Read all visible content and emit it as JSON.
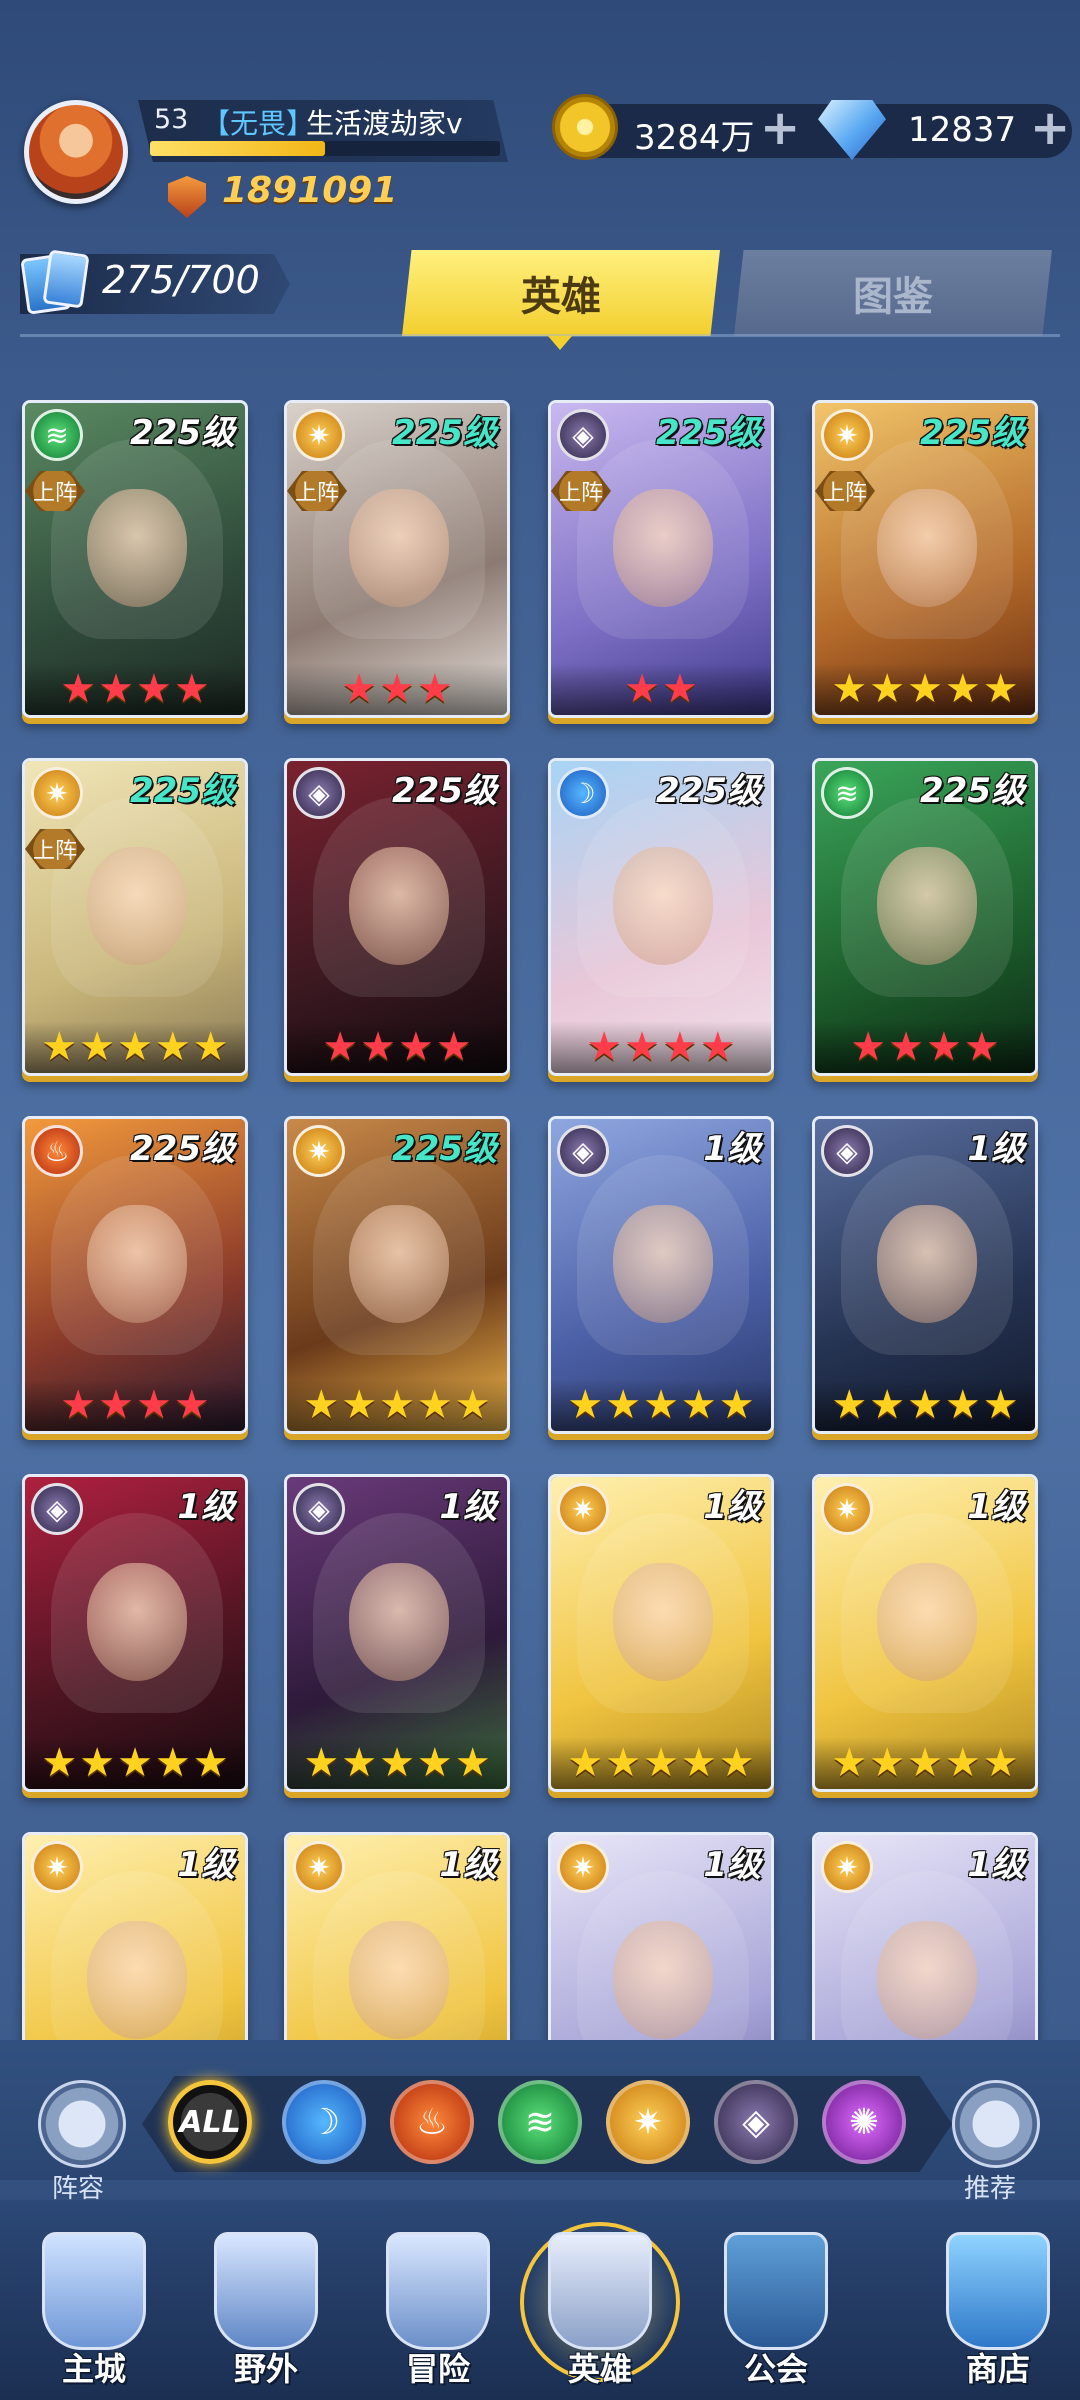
{
  "header": {
    "player_level": "53",
    "title_tag": "【无畏】",
    "player_name": "生活渡劫家v",
    "exp_progress": 0.5,
    "power": "1891091",
    "gold": "3284万",
    "diamonds": "12837",
    "plus": "+"
  },
  "hero_count": "275/700",
  "tabs": {
    "heroes": "英雄",
    "codex": "图鉴"
  },
  "deploy_label": "上阵",
  "heroes": [
    {
      "level": "225级",
      "level_color": "white",
      "faction": "wind",
      "deployed": true,
      "stars": 4,
      "star_color": "red"
    },
    {
      "level": "225级",
      "level_color": "teal",
      "faction": "light",
      "deployed": true,
      "stars": 3,
      "star_color": "red"
    },
    {
      "level": "225级",
      "level_color": "teal",
      "faction": "dark",
      "deployed": true,
      "stars": 2,
      "star_color": "red"
    },
    {
      "level": "225级",
      "level_color": "teal",
      "faction": "light",
      "deployed": true,
      "stars": 5,
      "star_color": "gold"
    },
    {
      "level": "225级",
      "level_color": "teal",
      "faction": "light",
      "deployed": true,
      "stars": 5,
      "star_color": "gold"
    },
    {
      "level": "225级",
      "level_color": "white",
      "faction": "dark",
      "deployed": false,
      "stars": 4,
      "star_color": "red"
    },
    {
      "level": "225级",
      "level_color": "white",
      "faction": "water",
      "deployed": false,
      "stars": 4,
      "star_color": "red"
    },
    {
      "level": "225级",
      "level_color": "white",
      "faction": "wind",
      "deployed": false,
      "stars": 4,
      "star_color": "red"
    },
    {
      "level": "225级",
      "level_color": "white",
      "faction": "fire",
      "deployed": false,
      "stars": 4,
      "star_color": "red"
    },
    {
      "level": "225级",
      "level_color": "teal",
      "faction": "light",
      "deployed": false,
      "stars": 5,
      "star_color": "gold"
    },
    {
      "level": "1级",
      "level_color": "white",
      "faction": "dark",
      "deployed": false,
      "stars": 5,
      "star_color": "gold"
    },
    {
      "level": "1级",
      "level_color": "white",
      "faction": "dark",
      "deployed": false,
      "stars": 5,
      "star_color": "gold"
    },
    {
      "level": "1级",
      "level_color": "white",
      "faction": "dark",
      "deployed": false,
      "stars": 5,
      "star_color": "gold"
    },
    {
      "level": "1级",
      "level_color": "white",
      "faction": "dark",
      "deployed": false,
      "stars": 5,
      "star_color": "gold"
    },
    {
      "level": "1级",
      "level_color": "white",
      "faction": "light",
      "deployed": false,
      "stars": 5,
      "star_color": "gold"
    },
    {
      "level": "1级",
      "level_color": "white",
      "faction": "light",
      "deployed": false,
      "stars": 5,
      "star_color": "gold"
    },
    {
      "level": "1级",
      "level_color": "white",
      "faction": "light",
      "deployed": false,
      "stars": 0,
      "star_color": "gold"
    },
    {
      "level": "1级",
      "level_color": "white",
      "faction": "light",
      "deployed": false,
      "stars": 0,
      "star_color": "gold"
    },
    {
      "level": "1级",
      "level_color": "white",
      "faction": "light",
      "deployed": false,
      "stars": 0,
      "star_color": "gold"
    },
    {
      "level": "1级",
      "level_color": "white",
      "faction": "light",
      "deployed": false,
      "stars": 0,
      "star_color": "gold"
    }
  ],
  "filter": {
    "lineup_label": "阵容",
    "recommend_label": "推荐",
    "all_label": "ALL",
    "factions": [
      "water",
      "fire",
      "wind",
      "light",
      "dark",
      "void"
    ]
  },
  "nav": [
    {
      "label": "主城",
      "icon": "castle-icon"
    },
    {
      "label": "野外",
      "icon": "portal-icon"
    },
    {
      "label": "冒险",
      "icon": "adventure-icon"
    },
    {
      "label": "英雄",
      "icon": "hero-helmet-icon",
      "active": true
    },
    {
      "label": "公会",
      "icon": "guild-banner-icon"
    },
    {
      "label": "商店",
      "icon": "shop-icon"
    }
  ],
  "colors": {
    "accent_yellow": "#f3cf2f",
    "teal_level": "#47e6c8",
    "star_red": "#ff3d4a",
    "star_gold": "#ffd21f"
  }
}
